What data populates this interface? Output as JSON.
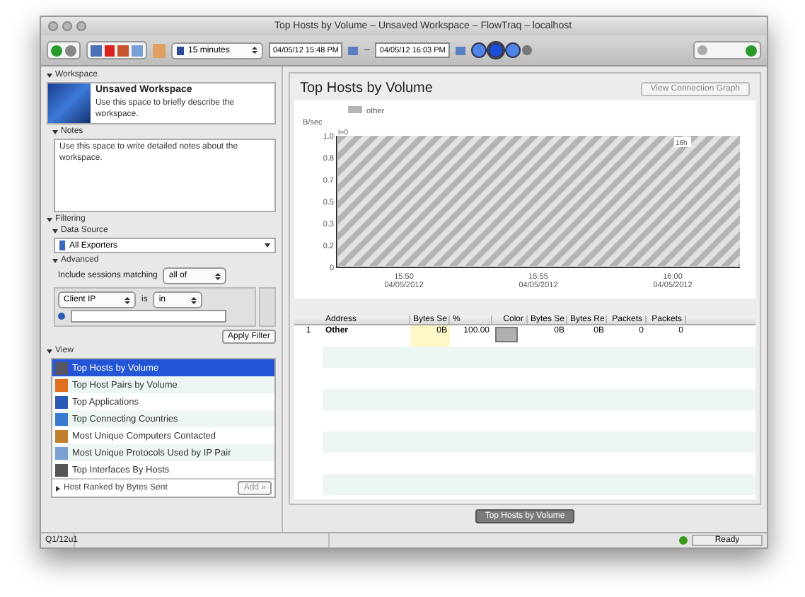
{
  "window": {
    "title": "Top Hosts by Volume – Unsaved Workspace – FlowTraq – localhost"
  },
  "toolbar": {
    "interval": "15 minutes",
    "start": "04/05/12 15:48 PM",
    "separator": "–",
    "end": "04/05/12 16:03 PM",
    "range_buttons": [
      {
        "selected": false
      },
      {
        "selected": true
      },
      {
        "selected": false
      }
    ]
  },
  "workspace": {
    "header": "Workspace",
    "expanded": true,
    "name": "Unsaved Workspace",
    "description": "Use this space to briefly describe the workspace.",
    "notes_header": "Notes",
    "notes": "Use this space to write detailed notes about the workspace."
  },
  "filtering": {
    "header": "Filtering",
    "data_source_header": "Data Source",
    "data_source": "All Exporters",
    "advanced_header": "Advanced",
    "include_label": "Include sessions matching",
    "match": "all of",
    "field": "Client IP",
    "operator_label": "is",
    "operator": "in",
    "apply": "Apply Filter"
  },
  "view": {
    "header": "View",
    "items": [
      {
        "label": "Top Hosts by Volume",
        "selected": true
      },
      {
        "label": "Top Host Pairs by Volume",
        "selected": false
      },
      {
        "label": "Top Applications",
        "selected": false
      },
      {
        "label": "Top Connecting Countries",
        "selected": false
      },
      {
        "label": "Most Unique Computers Contacted",
        "selected": false
      },
      {
        "label": "Most Unique Protocols Used by IP Pair",
        "selected": false
      },
      {
        "label": "Top Interfaces By Hosts",
        "selected": false
      }
    ],
    "footer": "Host Ranked by Bytes Sent",
    "footer_expanded": false,
    "add": "Add »"
  },
  "report": {
    "title": "Top Hosts by Volume",
    "graph_button": "View Connection Graph",
    "chart": {
      "legend": "other",
      "ylabel": "B/sec",
      "y_labels": [
        "1.0",
        "0.8",
        "0.7",
        "0.5",
        "0.3",
        "0.2",
        "0"
      ],
      "x_labels": [
        "15:50 04/05/2012",
        "15:55 04/05/2012",
        "16:00 04/05/2012"
      ],
      "annotations": [
        "t=0",
        "16h"
      ]
    },
    "table": {
      "columns": [
        "Address",
        "Bytes Se",
        "%",
        "Color",
        "Bytes Se",
        "Bytes Re",
        "Packets",
        "Packets"
      ],
      "rows": [
        {
          "index": "1",
          "address": "Other",
          "bytes_sent": "0B",
          "percent": "100.00",
          "color": "#b0b0b0",
          "bytes_sent_2": "0B",
          "bytes_received": "0B",
          "packets_1": "0",
          "packets_2": "0"
        }
      ]
    },
    "tab": "Top Hosts by Volume"
  },
  "status_bar": {
    "left": "Q1/12u1",
    "state": "Ready"
  }
}
